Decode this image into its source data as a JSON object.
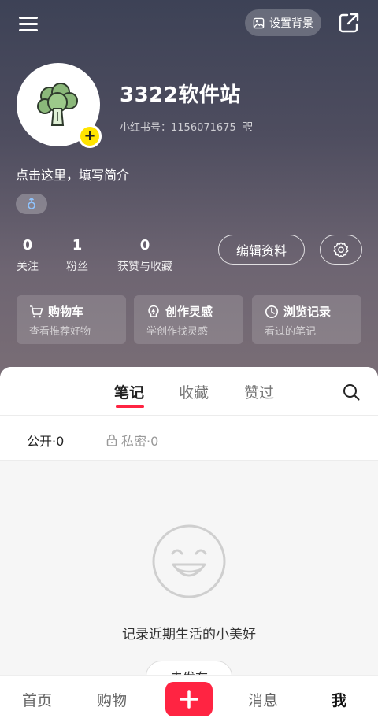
{
  "colors": {
    "accent": "#ff2442",
    "avatar_badge": "#ffe400"
  },
  "topbar": {
    "set_background_label": "设置背景",
    "icons": [
      "menu-icon",
      "image-icon",
      "share-icon"
    ]
  },
  "profile": {
    "username": "3322软件站",
    "red_id": "小红书号：1156071675",
    "bio": "点击这里，填写简介",
    "avatar_badge": "+"
  },
  "stats": [
    {
      "num": "0",
      "label": "关注"
    },
    {
      "num": "1",
      "label": "粉丝"
    },
    {
      "num": "0",
      "label": "获赞与收藏"
    }
  ],
  "actions": {
    "edit_label": "编辑资料"
  },
  "cards": [
    {
      "title": "购物车",
      "sub": "查看推荐好物",
      "icon": "cart-icon"
    },
    {
      "title": "创作灵感",
      "sub": "学创作找灵感",
      "icon": "bulb-icon"
    },
    {
      "title": "浏览记录",
      "sub": "看过的笔记",
      "icon": "clock-icon"
    }
  ],
  "tabs": [
    "笔记",
    "收藏",
    "赞过"
  ],
  "subtabs": {
    "public": "公开·0",
    "private": "私密·0"
  },
  "empty": {
    "text": "记录近期生活的小美好",
    "button": "去发布"
  },
  "nav": [
    "首页",
    "购物",
    "消息",
    "我"
  ]
}
